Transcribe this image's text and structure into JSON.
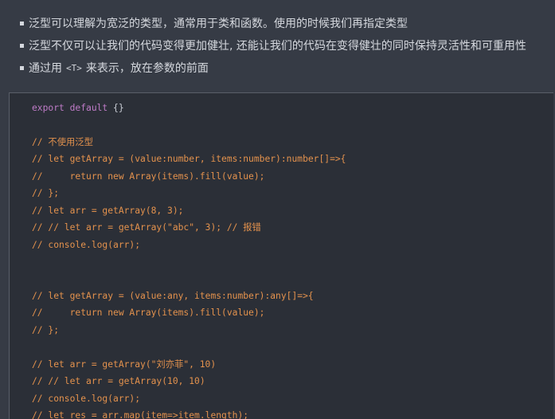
{
  "bullets": [
    {
      "text": "泛型可以理解为宽泛的类型，通常用于类和函数。使用的时候我们再指定类型"
    },
    {
      "text": "泛型不仅可以让我们的代码变得更加健壮, 还能让我们的代码在变得健壮的同时保持灵活性和可重用性"
    },
    {
      "before": "通过用",
      "code": "<T>",
      "after": "来表示，放在参数的前面"
    }
  ],
  "code": {
    "line1_kw": "export default",
    "line1_rest": " {}",
    "comments": [
      "// 不使用泛型",
      "// let getArray = (value:number, items:number):number[]=>{",
      "//     return new Array(items).fill(value);",
      "// };",
      "// let arr = getArray(8, 3);",
      "// // let arr = getArray(\"abc\", 3); // 报错",
      "// console.log(arr);",
      "// let getArray = (value:any, items:number):any[]=>{",
      "//     return new Array(items).fill(value);",
      "// };",
      "// let arr = getArray(\"刘亦菲\", 10)",
      "// // let arr = getArray(10, 10)",
      "// console.log(arr);",
      "// let res = arr.map(item=>item.length);"
    ]
  }
}
